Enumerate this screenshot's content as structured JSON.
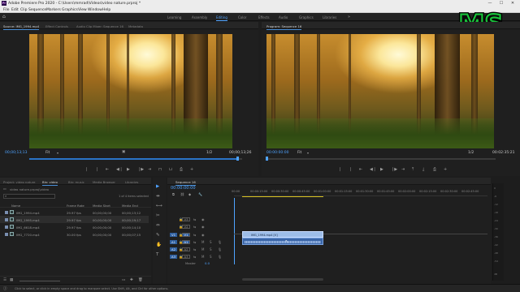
{
  "app": {
    "logo_text": "Pr",
    "title": "Adobe Premiere Pro 2020 - C:\\Users\\mmrad\\Videos\\video nature.prproj *",
    "window_controls": [
      "—",
      "☐",
      "✕"
    ]
  },
  "menu": [
    "File",
    "Edit",
    "Clip",
    "Sequence",
    "Markers",
    "Graphics",
    "View",
    "Window",
    "Help"
  ],
  "workspaces": {
    "tabs": [
      {
        "label": "Learning",
        "active": false
      },
      {
        "label": "Assembly",
        "active": false
      },
      {
        "label": "Editing",
        "active": true
      },
      {
        "label": "Color",
        "active": false
      },
      {
        "label": "Effects",
        "active": false
      },
      {
        "label": "Audio",
        "active": false
      },
      {
        "label": "Graphics",
        "active": false
      },
      {
        "label": "Libraries",
        "active": false
      }
    ],
    "more_label": "»"
  },
  "brand_logo": {
    "text": "MS",
    "color": "#18c23a"
  },
  "source_monitor": {
    "tabs": [
      "Source: IMG_1994.mp4",
      "Effect Controls",
      "Audio Clip Mixer: Sequence 16",
      "Metadata"
    ],
    "timecode_in": "00;00;13;13",
    "fit_label": "Fit",
    "page_label": "1/2",
    "duration": "00;00;13;26",
    "scrub_fraction": 0.98
  },
  "program_monitor": {
    "tab": "Program: Sequence 16",
    "timecode_in": "00:00:00:00",
    "fit_label": "Fit",
    "page_label": "1/2",
    "duration": "00:02:35:21",
    "scrub_fraction": 0.0
  },
  "transport": {
    "source_buttons": [
      "❘",
      "❘",
      "⇤",
      "◀❘",
      "▶",
      "❘▶",
      "⇥",
      "⊓",
      "⊔",
      "⎙",
      "+"
    ],
    "program_buttons": [
      "❘",
      "❘",
      "⇤",
      "◀❘",
      "▶",
      "❘▶",
      "⇥",
      "⤒",
      "⤓",
      "⎙",
      "+"
    ]
  },
  "project_panel": {
    "tabs": [
      "Project: video nature",
      "Bin: video",
      "Bin: music",
      "Media Browser",
      "Libraries"
    ],
    "path": "video nature.prproj\\video",
    "items_info": "1 of 4 items selected",
    "columns": [
      "Name",
      "Frame Rate",
      "Media Start",
      "Media End"
    ],
    "rows": [
      {
        "name": "IMG_1994.mp4",
        "fps": "29.97 fps",
        "start": "00;00;00;00",
        "end": "00;00;13;12"
      },
      {
        "name": "IMG_1995.mp4",
        "fps": "29.97 fps",
        "start": "00;00;00;00",
        "end": "00;00;19;17"
      },
      {
        "name": "IMG_6618.mp4",
        "fps": "29.97 fps",
        "start": "00;00;00;00",
        "end": "00;00;14;10"
      },
      {
        "name": "IMG_7720.mp4",
        "fps": "30.00 fps",
        "start": "00;00;00;00",
        "end": "00;00;07;15"
      }
    ],
    "selected_row": 1
  },
  "tools": [
    "▶",
    "⇹",
    "⟷",
    "✂",
    "⇔",
    "✎",
    "✋",
    "T"
  ],
  "timeline": {
    "tab": "Sequence 16",
    "timecode": "00:00:00:00",
    "ruler": [
      "00:00",
      "00:00:15:00",
      "00:00:30:00",
      "00:00:45:00",
      "00:01:00:00",
      "00:01:15:00",
      "00:01:30:00",
      "00:01:45:00",
      "00:02:00:00",
      "00:02:15:00",
      "00:02:30:00",
      "00:02:45:00",
      "00:03:00:00"
    ],
    "video_tracks": [
      {
        "name": "V3",
        "src": ""
      },
      {
        "name": "V2",
        "src": ""
      },
      {
        "name": "V1",
        "src": "V1"
      }
    ],
    "audio_tracks": [
      {
        "name": "A1",
        "src": "A1",
        "m": "M",
        "s": "S"
      },
      {
        "name": "A2",
        "src": "A2",
        "m": "M",
        "s": "S"
      },
      {
        "name": "A3",
        "src": "A3",
        "m": "M",
        "s": "S"
      }
    ],
    "master_label": "Master",
    "master_value": "0.0",
    "clip_label": "IMG_1994.mp4 [V]",
    "vu_labels": [
      "0",
      "-6",
      "-12",
      "-18",
      "-24",
      "-30",
      "-36",
      "-42",
      "-48",
      "-54",
      "dB"
    ]
  },
  "status": {
    "text": "Click to select, or click in empty space and drag to marquee select. Use Shift, Alt, and Ctrl for other options."
  }
}
